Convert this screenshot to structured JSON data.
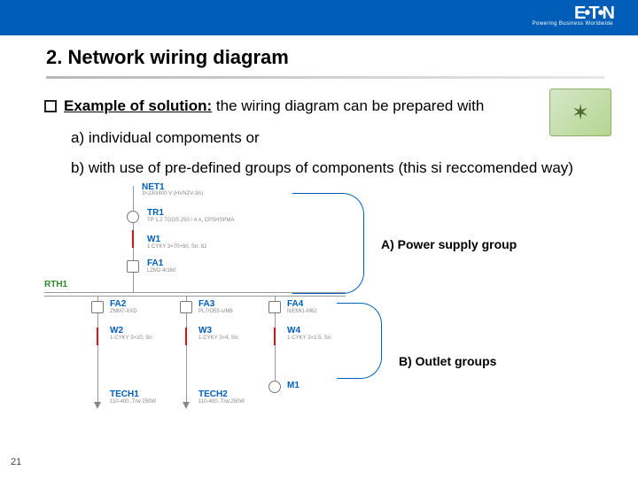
{
  "brand": {
    "name": "E•T•N",
    "tagline": "Powering Business Worldwide"
  },
  "title": "2. Network wiring diagram",
  "bullet": {
    "lead": "Example of solution:",
    "text": "the wiring diagram can be prepared with"
  },
  "body": {
    "a": "a) individual compoments or",
    "b": "b) with use of pre-defined groups of components (this si reccomended way)"
  },
  "corner_icon": "✶",
  "callouts": {
    "a": "A)  Power supply group",
    "b": "B) Outlet  groups"
  },
  "diagram": {
    "rth": "RTH1",
    "net": {
      "name": "NET1",
      "sub": "3×230/400 V (HVNZV-3A)"
    },
    "tr": {
      "name": "TR1",
      "sub": "TP 1.2 TGGS 250 / 4 A, CPSHSPMA"
    },
    "w1": {
      "name": "W1",
      "sub": "1 CYKY 3×70+50, Sn: 82"
    },
    "fa1": {
      "name": "FA1",
      "sub": "LZM2-4/160"
    },
    "fa2": {
      "name": "FA2",
      "sub": "ZNM7-XXD"
    },
    "fa3": {
      "name": "FA3",
      "sub": "PL7/O55-s/M6"
    },
    "fa4": {
      "name": "FA4",
      "sub": "N/EMI1-M62"
    },
    "w2": {
      "name": "W2",
      "sub": "1-CYKY 3×10, Sn:"
    },
    "w3": {
      "name": "W3",
      "sub": "1-CYKY 3×4, Sn:"
    },
    "w4": {
      "name": "W4",
      "sub": "1-CYKY 3×2.5, Sn:"
    },
    "t1": {
      "name": "TECH1",
      "sub": "110-400..Trw:250W"
    },
    "t2": {
      "name": "TECH2",
      "sub": "110-400..Trw:250W"
    },
    "m1": {
      "name": "M1",
      "sub": ""
    }
  },
  "page_number": "21"
}
